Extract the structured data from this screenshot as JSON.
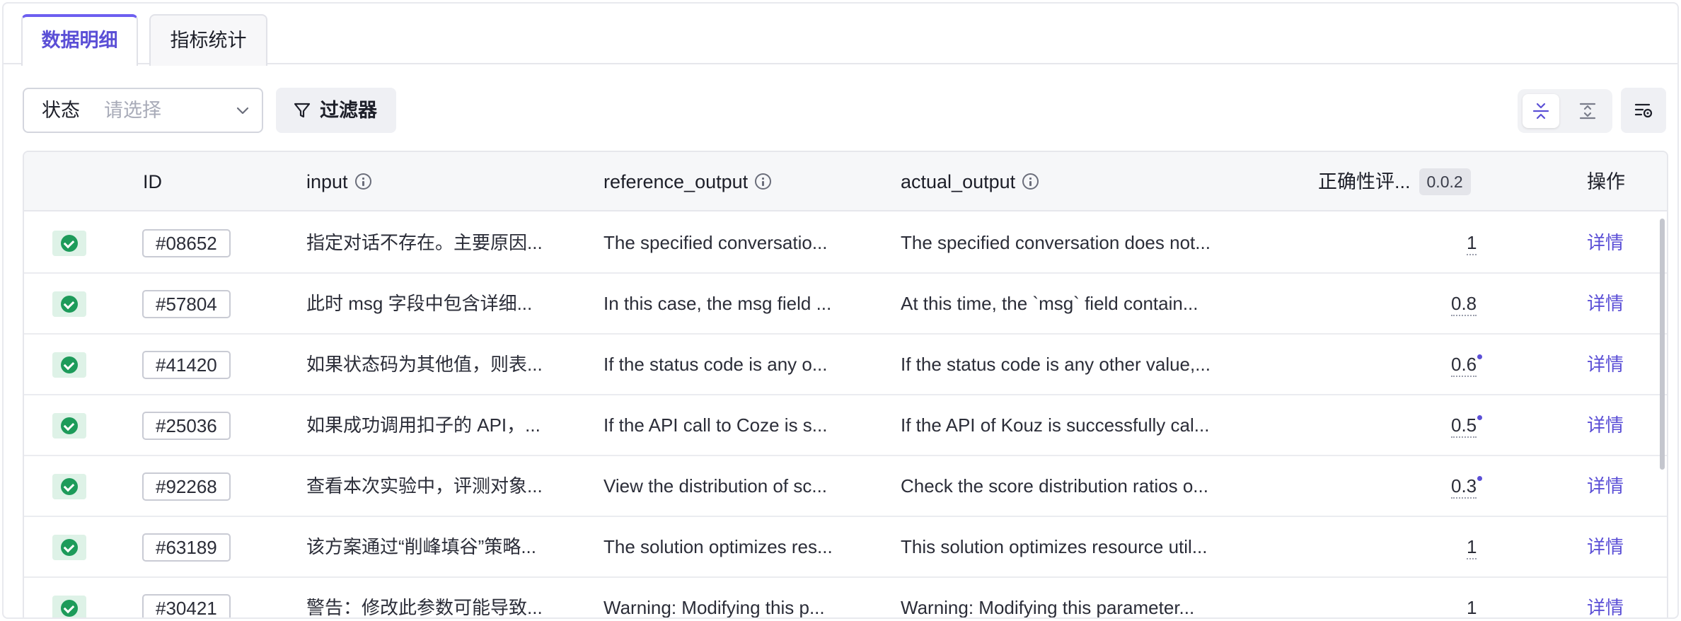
{
  "tabs": [
    {
      "label": "数据明细",
      "active": true
    },
    {
      "label": "指标统计",
      "active": false
    }
  ],
  "toolbar": {
    "status_label": "状态",
    "status_placeholder": "请选择",
    "filter_label": "过滤器"
  },
  "table": {
    "headers": {
      "id": "ID",
      "input": "input",
      "reference_output": "reference_output",
      "actual_output": "actual_output",
      "score": "正确性评...",
      "score_version": "0.0.2",
      "ops": "操作"
    },
    "rows": [
      {
        "id": "#08652",
        "input": "指定对话不存在。主要原因...",
        "reference_output": "The specified conversatio...",
        "actual_output": "The specified conversation does not...",
        "score": "1",
        "marked": false,
        "action": "详情"
      },
      {
        "id": "#57804",
        "input": "此时 msg 字段中包含详细...",
        "reference_output": "In this case, the msg field ...",
        "actual_output": "At this time, the `msg` field contain...",
        "score": "0.8",
        "marked": false,
        "action": "详情"
      },
      {
        "id": "#41420",
        "input": "如果状态码为其他值，则表...",
        "reference_output": "If the status code is any o...",
        "actual_output": "If the status code is any other value,...",
        "score": "0.6",
        "marked": true,
        "action": "详情"
      },
      {
        "id": "#25036",
        "input": "如果成功调用扣子的 API，...",
        "reference_output": "If the API call to Coze is s...",
        "actual_output": "If the API of Kouz is successfully cal...",
        "score": "0.5",
        "marked": true,
        "action": "详情"
      },
      {
        "id": "#92268",
        "input": "查看本次实验中，评测对象...",
        "reference_output": "View the distribution of sc...",
        "actual_output": "Check the score distribution ratios o...",
        "score": "0.3",
        "marked": true,
        "action": "详情"
      },
      {
        "id": "#63189",
        "input": "该方案通过“削峰填谷”策略...",
        "reference_output": "The solution optimizes res...",
        "actual_output": "This solution optimizes resource util...",
        "score": "1",
        "marked": false,
        "action": "详情"
      },
      {
        "id": "#30421",
        "input": "警告：修改此参数可能导致...",
        "reference_output": "Warning: Modifying this p...",
        "actual_output": "Warning: Modifying this parameter...",
        "score": "1",
        "marked": false,
        "action": "详情"
      }
    ]
  },
  "colors": {
    "accent": "#5b4fd6",
    "success": "#1d9b5a"
  },
  "icons": [
    "filter-icon",
    "chevron-down-icon",
    "compact-density-icon",
    "expand-density-icon",
    "column-settings-icon",
    "info-icon",
    "check-circle-icon"
  ]
}
